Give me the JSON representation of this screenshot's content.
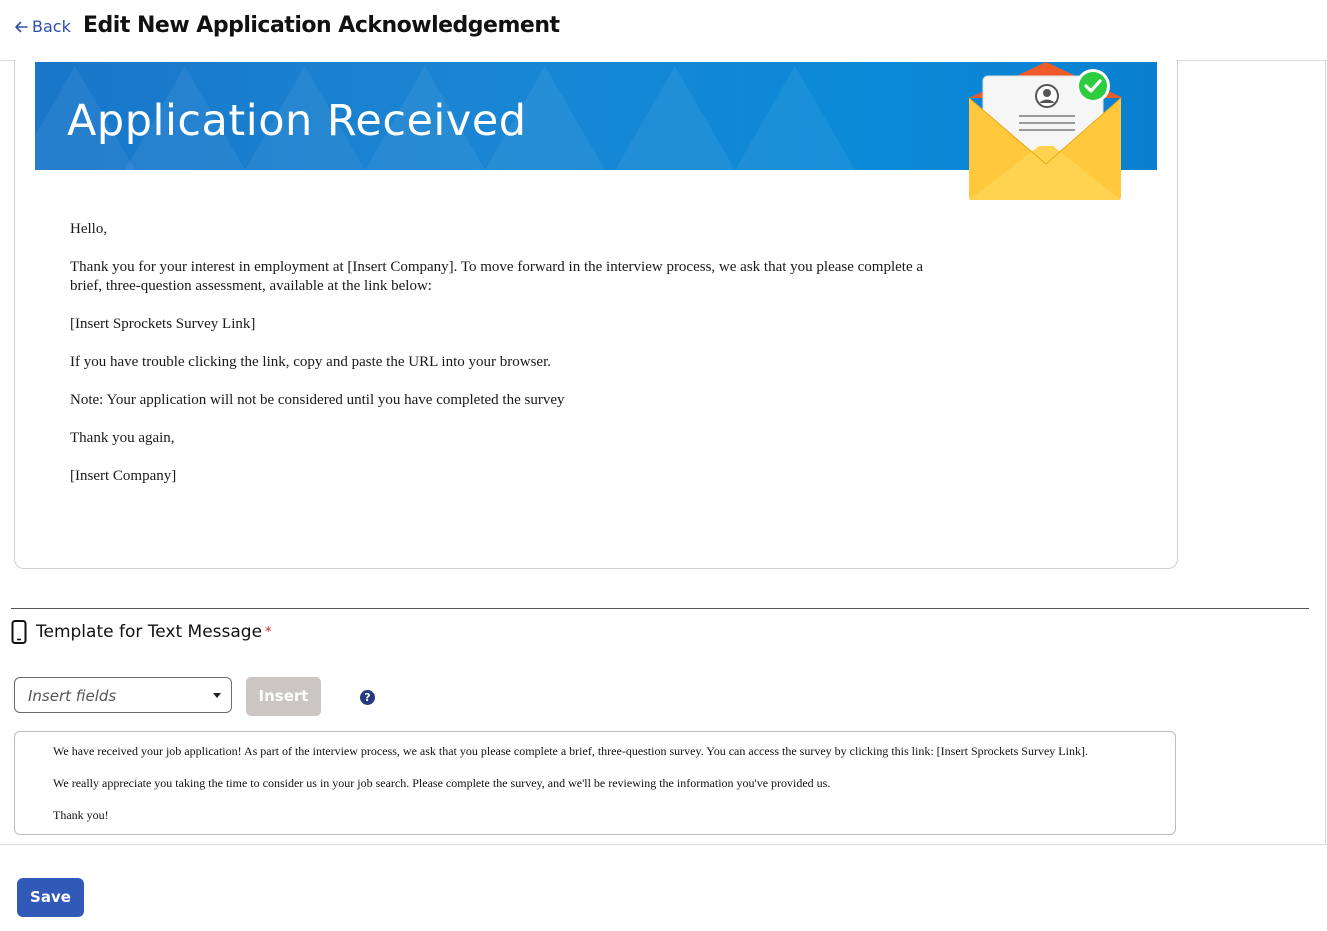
{
  "header": {
    "back_label": "Back",
    "title": "Edit New Application Acknowledgement"
  },
  "email_preview": {
    "banner_title": "Application Received",
    "icon": "envelope-check-icon",
    "paragraphs": [
      "Hello,",
      "Thank you for your interest in employment at [Insert Company]. To move forward in the interview process, we ask that you please complete a brief, three-question assessment, available at the link below:",
      "[Insert Sprockets Survey Link]",
      "If you have trouble clicking the link, copy and paste the URL into your browser.",
      "Note: Your application will not be considered until you have completed the survey",
      "Thank you again,",
      "[Insert Company]"
    ]
  },
  "sms_section": {
    "heading": "Template for Text Message",
    "required_marker": "*",
    "icon": "phone-icon",
    "insert_fields_placeholder": "Insert fields",
    "insert_button_label": "Insert",
    "help_label": "?",
    "message_lines": [
      "We have received your job application! As part of the interview process, we ask that you please complete a brief, three-question survey. You can access the survey by clicking this link: [Insert Sprockets Survey Link].",
      "We really appreciate you taking the time to consider us in your job search. Please complete the survey, and we'll be reviewing the information you've provided us.",
      "Thank you!"
    ]
  },
  "footer": {
    "save_label": "Save"
  },
  "colors": {
    "accent": "#3159b8",
    "link": "#2e4fa8",
    "banner": "#1a86d3",
    "required": "#d21f1f",
    "disabled_button": "#cbc6c4"
  }
}
